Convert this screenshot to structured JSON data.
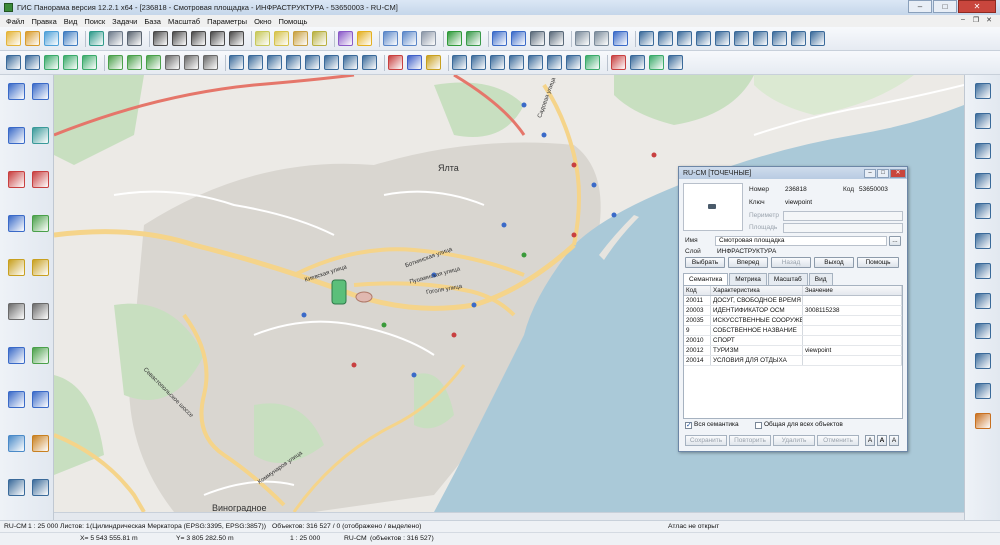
{
  "window": {
    "title": "ГИС Панорама версия 12.2.1 x64 - [236818 - Смотровая площадка - ИНФРАСТРУКТУРА - 53650003 - RU-CM]",
    "minimize": "–",
    "maximize": "□",
    "close": "✕"
  },
  "menu": [
    "Файл",
    "Правка",
    "Вид",
    "Поиск",
    "Задачи",
    "База",
    "Масштаб",
    "Параметры",
    "Окно",
    "Помощь"
  ],
  "mdi": {
    "minimize": "–",
    "restore": "❐",
    "close": "✕"
  },
  "toolbar1": {
    "icons": [
      {
        "name": "new-map-icon",
        "color": "#e4b43a"
      },
      {
        "name": "open-icon",
        "color": "#d89b2c"
      },
      {
        "name": "add-data-icon",
        "color": "#4ea0d8"
      },
      {
        "name": "save-icon",
        "color": "#3e7bc0"
      },
      {
        "sep": true
      },
      {
        "name": "layers-icon",
        "color": "#2f9a8a"
      },
      {
        "name": "print-icon",
        "color": "#6d7a8a"
      },
      {
        "name": "list-icon",
        "color": "#5a6470"
      },
      {
        "sep": true
      },
      {
        "name": "binoculars-icon",
        "color": "#4a4a4a"
      },
      {
        "name": "find-icon",
        "color": "#4a4a4a"
      },
      {
        "name": "find-next-icon",
        "color": "#4a4a4a"
      },
      {
        "name": "find-area-icon",
        "color": "#4a4a4a"
      },
      {
        "name": "find-prev-icon",
        "color": "#4a4a4a"
      },
      {
        "sep": true
      },
      {
        "name": "select-icon",
        "color": "#c7c85a"
      },
      {
        "name": "select-area-icon",
        "color": "#d6c24a"
      },
      {
        "name": "select-layer-icon",
        "color": "#c8a040"
      },
      {
        "name": "unselect-icon",
        "color": "#b8b040"
      },
      {
        "sep": true
      },
      {
        "name": "color-wheel-icon",
        "color": "#8a5ac8"
      },
      {
        "name": "lightning-icon",
        "color": "#e4b020"
      },
      {
        "sep": true
      },
      {
        "name": "zoom-in-icon",
        "color": "#5a86c8"
      },
      {
        "name": "zoom-out-icon",
        "color": "#5a86c8"
      },
      {
        "name": "zoom-1to1-icon",
        "color": "#8a96a6"
      },
      {
        "sep": true
      },
      {
        "name": "check-icon",
        "color": "#2f9a3a"
      },
      {
        "name": "back-icon",
        "color": "#3a9a4a"
      },
      {
        "sep": true
      },
      {
        "name": "cursor-icon",
        "color": "#3a6ac8"
      },
      {
        "name": "object-info-icon",
        "color": "#3a6ac8"
      },
      {
        "name": "text-object-icon",
        "color": "#5a6a7a"
      },
      {
        "name": "attribute-icon",
        "color": "#5a6a7a"
      },
      {
        "sep": true
      },
      {
        "name": "eraser-icon",
        "color": "#7a8a9a"
      },
      {
        "name": "clear-icon",
        "color": "#7a8a9a"
      },
      {
        "name": "help-cursor-icon",
        "color": "#3a6ac8"
      },
      {
        "sep": true
      },
      {
        "name": "vertex-edit-icon",
        "color": "#3a6a9a"
      },
      {
        "name": "line-split-icon",
        "color": "#3a6a9a"
      },
      {
        "name": "line-join-icon",
        "color": "#3a6a9a"
      },
      {
        "name": "line-cross-icon",
        "color": "#3a6a9a"
      },
      {
        "name": "line-move-icon",
        "color": "#3a6a9a"
      },
      {
        "name": "line-copy-icon",
        "color": "#3a6a9a"
      },
      {
        "name": "line-rotate-icon",
        "color": "#3a6a9a"
      },
      {
        "name": "line-scale-icon",
        "color": "#3a6a9a"
      },
      {
        "name": "line-mirror-icon",
        "color": "#3a6a9a"
      },
      {
        "name": "line-delete-icon",
        "color": "#3a6a9a"
      }
    ]
  },
  "toolbar2": {
    "icons": [
      {
        "name": "edit-object-icon",
        "color": "#3a6a9a"
      },
      {
        "name": "create-line-icon",
        "color": "#3a6a9a"
      },
      {
        "name": "create-polygon-icon",
        "color": "#3aaa6a"
      },
      {
        "name": "create-point-icon",
        "color": "#3aaa6a"
      },
      {
        "name": "create-label-icon",
        "color": "#3aaa6a"
      },
      {
        "sep": true
      },
      {
        "name": "copy-object-icon",
        "color": "#4aa04a"
      },
      {
        "name": "move-object-icon",
        "color": "#4aa04a"
      },
      {
        "name": "rotate-object-icon",
        "color": "#4aa04a"
      },
      {
        "name": "text-abc-icon",
        "color": "#6a6a6a"
      },
      {
        "name": "text-edit-icon",
        "color": "#6a6a6a"
      },
      {
        "name": "pencil-icon",
        "color": "#6a6a6a"
      },
      {
        "sep": true
      },
      {
        "name": "node-add-icon",
        "color": "#3a6a9a"
      },
      {
        "name": "node-move-icon",
        "color": "#3a6a9a"
      },
      {
        "name": "node-delete-icon",
        "color": "#3a6a9a"
      },
      {
        "name": "arc-icon",
        "color": "#3a6a9a"
      },
      {
        "name": "circle-icon",
        "color": "#3a6a9a"
      },
      {
        "name": "spline-icon",
        "color": "#3a6a9a"
      },
      {
        "name": "parallel-icon",
        "color": "#3a6a9a"
      },
      {
        "name": "offset-icon",
        "color": "#3a6a9a"
      },
      {
        "sep": true
      },
      {
        "name": "symbol-red-icon",
        "color": "#c84040"
      },
      {
        "name": "symbol-blue-icon",
        "color": "#4060c8"
      },
      {
        "name": "symbol-yellow-icon",
        "color": "#c8a020"
      },
      {
        "sep": true
      },
      {
        "name": "cut-icon",
        "color": "#3a6a9a"
      },
      {
        "name": "glue-icon",
        "color": "#3a6a9a"
      },
      {
        "name": "merge-icon",
        "color": "#3a6a9a"
      },
      {
        "name": "split-icon",
        "color": "#3a6a9a"
      },
      {
        "name": "union-icon",
        "color": "#3a6a9a"
      },
      {
        "name": "diff-icon",
        "color": "#3a6a9a"
      },
      {
        "name": "intersect-icon",
        "color": "#3a6a9a"
      },
      {
        "name": "grid-icon",
        "color": "#3aaa6a"
      },
      {
        "sep": true
      },
      {
        "name": "delete-point-icon",
        "color": "#c84040"
      },
      {
        "name": "envelope-icon",
        "color": "#3a6a9a"
      },
      {
        "name": "map-fragment-icon",
        "color": "#3aaa6a"
      },
      {
        "name": "snap-icon",
        "color": "#3a6a9a"
      }
    ]
  },
  "map": {
    "city_label": "Ялта",
    "town_label": "Виноградное",
    "streets": [
      {
        "name": "Садовая улица"
      },
      {
        "name": "Боткинская улица"
      },
      {
        "name": "Пушкинская улица"
      },
      {
        "name": "Киевская улица"
      },
      {
        "name": "Гоголя улица"
      },
      {
        "name": "Севастопольское шоссе"
      },
      {
        "name": "Коммунаров улица"
      }
    ],
    "colors": {
      "land": "#eceae6",
      "sea": "#aac9d8",
      "park": "#c8dfc0",
      "road_major": "#f5d48a",
      "road_red": "#e5766a",
      "road_white": "#ffffff",
      "urban": "#d9d6d0"
    }
  },
  "properties": {
    "title": "RU-CM [ТОЧЕЧНЫЕ]",
    "number_label": "Номер",
    "number_value": "236818",
    "code_label": "Код",
    "code_value": "53650003",
    "key_label": "Ключ",
    "key_value": "viewpoint",
    "perimeter_label": "Периметр",
    "area_label": "Площадь",
    "name_label": "Имя",
    "name_value": "Смотровая площадка",
    "more_label": "...",
    "layer_label": "Слой",
    "layer_value": "ИНФРАСТРУКТУРА",
    "buttons": {
      "select": "Выбрать",
      "forward": "Вперед",
      "back": "Назад",
      "exit": "Выход",
      "help": "Помощь"
    },
    "tabs": [
      "Семантика",
      "Метрика",
      "Масштаб",
      "Вид"
    ],
    "columns": [
      "Код",
      "Характеристика",
      "Значение"
    ],
    "rows": [
      [
        "20011",
        "ДОСУГ, СВОБОДНОЕ ВРЕМЯ",
        ""
      ],
      [
        "20003",
        "ИДЕНТИФИКАТОР ОСМ",
        "3008115238"
      ],
      [
        "20035",
        "ИСКУССТВЕННЫЕ СООРУЖЕН",
        ""
      ],
      [
        "9",
        "СОБСТВЕННОЕ НАЗВАНИЕ",
        ""
      ],
      [
        "20010",
        "СПОРТ",
        ""
      ],
      [
        "20012",
        "ТУРИЗМ",
        "viewpoint"
      ],
      [
        "20014",
        "УСЛОВИЯ ДЛЯ ОТДЫХА",
        ""
      ]
    ],
    "all_semantics_label": "Вся семантика",
    "all_semantics_checked": true,
    "common_for_all_label": "Общая для всех объектов",
    "common_for_all_checked": false,
    "bottom_buttons": {
      "save": "Сохранить",
      "repeat": "Повторить",
      "delete": "Удалить",
      "cancel": "Отменить"
    },
    "a_buttons": [
      "A",
      "A",
      "A"
    ]
  },
  "status1": {
    "map_name": "RU-CM",
    "scale": "1 : 25 000",
    "sheets": "Листов: 1",
    "projection": "(Цилиндрическая Меркатора (EPSG:3395, EPSG:3857))",
    "objects": "Объектов: 316 527 / 0 (отображено / выделено)",
    "atlas": "Атлас не открыт"
  },
  "status2": {
    "x": "X= 5 543 555.81 m",
    "y": "Y= 3 805 282.50 m",
    "scale": "1 : 25 000",
    "map": "RU-CM",
    "objects": "(объектов : 316 527)"
  }
}
